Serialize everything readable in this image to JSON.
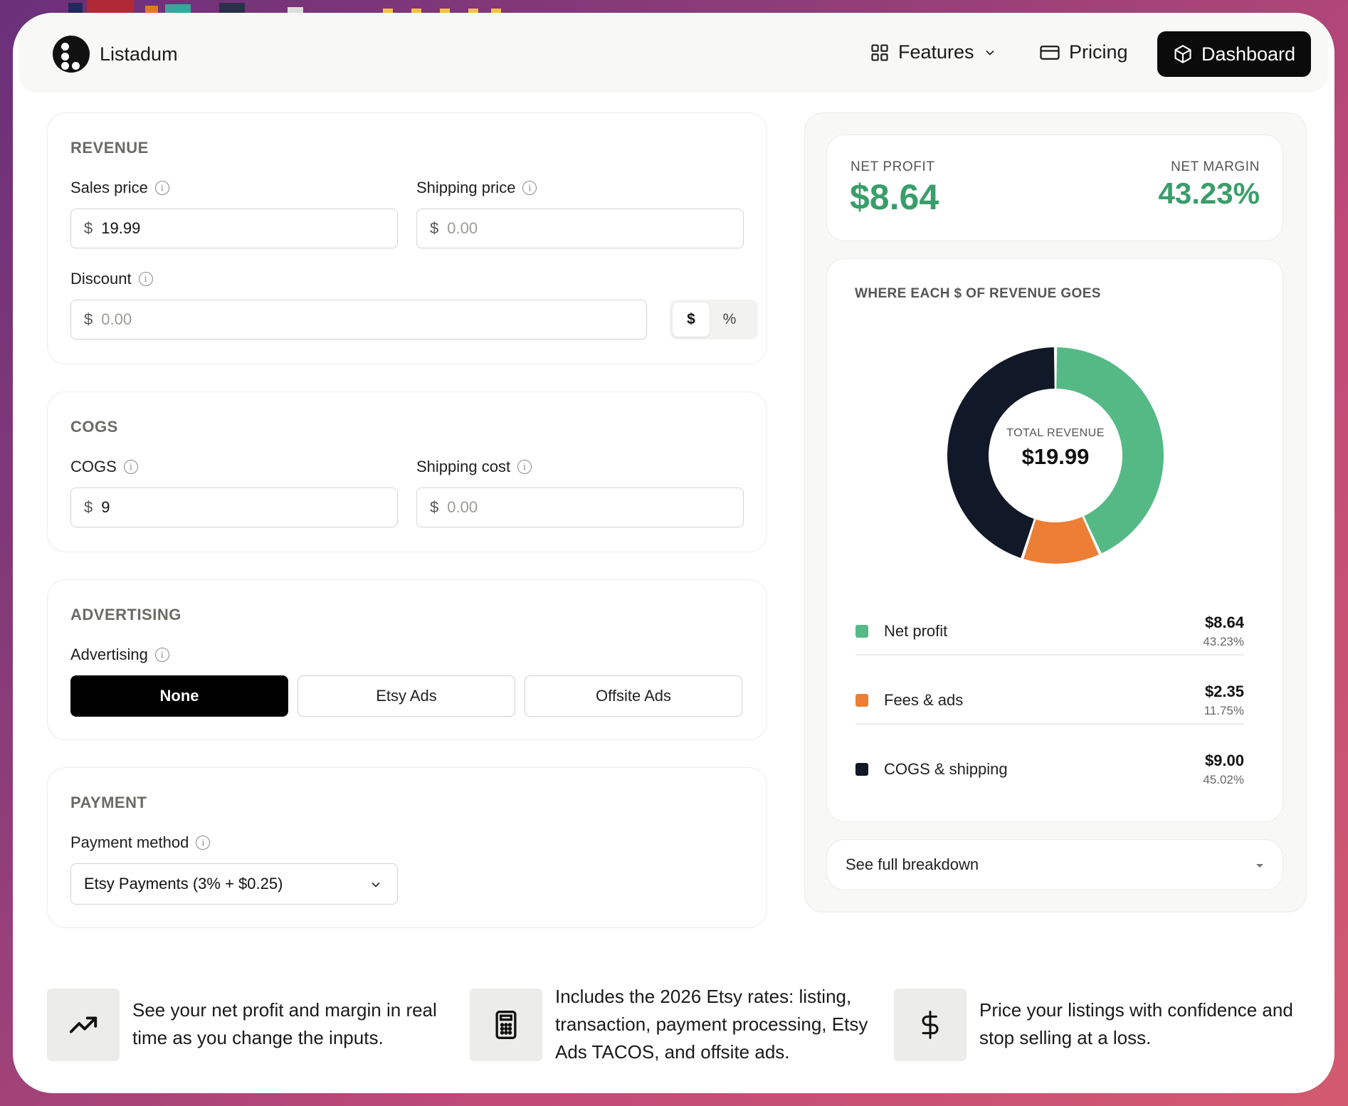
{
  "nav": {
    "brand": "Listadum",
    "features_label": "Features",
    "pricing_label": "Pricing",
    "dashboard_label": "Dashboard"
  },
  "revenue": {
    "title": "REVENUE",
    "sales_price_label": "Sales price",
    "sales_price_value": "19.99",
    "shipping_price_label": "Shipping price",
    "shipping_price_placeholder": "0.00",
    "discount_label": "Discount",
    "discount_placeholder": "0.00",
    "toggle_dollar": "$",
    "toggle_percent": "%",
    "currency": "$"
  },
  "cogs": {
    "title": "COGS",
    "cogs_label": "COGS",
    "cogs_value": "9",
    "shipping_cost_label": "Shipping cost",
    "shipping_cost_placeholder": "0.00"
  },
  "advertising": {
    "title": "ADVERTISING",
    "label": "Advertising",
    "options": [
      "None",
      "Etsy Ads",
      "Offsite Ads"
    ],
    "selected": "None"
  },
  "payment": {
    "title": "PAYMENT",
    "label": "Payment method",
    "selected": "Etsy Payments (3% + $0.25)"
  },
  "summary": {
    "net_profit_label": "NET PROFIT",
    "net_profit_value": "$8.64",
    "net_margin_label": "NET MARGIN",
    "net_margin_value": "43.23%"
  },
  "chart_data": {
    "type": "pie",
    "title": "WHERE EACH $ OF REVENUE GOES",
    "center_label": "TOTAL REVENUE",
    "center_value": "$19.99",
    "categories": [
      "Net profit",
      "Fees & ads",
      "COGS & shipping"
    ],
    "values": [
      8.64,
      2.35,
      9.0
    ],
    "amount_labels": [
      "$8.64",
      "$2.35",
      "$9.00"
    ],
    "percent_labels": [
      "43.23%",
      "11.75%",
      "45.02%"
    ],
    "colors": [
      "#55b986",
      "#ec7f35",
      "#111827"
    ]
  },
  "breakdown": {
    "label": "See full breakdown"
  },
  "features": [
    {
      "icon": "trending-up-icon",
      "text": "See your net profit and margin in real time as you change the inputs."
    },
    {
      "icon": "calculator-icon",
      "text": "Includes the 2026 Etsy rates: listing, transaction, payment processing, Etsy Ads TACOS, and offsite ads."
    },
    {
      "icon": "dollar-icon",
      "text": "Price your listings with confidence and stop selling at a loss."
    }
  ]
}
